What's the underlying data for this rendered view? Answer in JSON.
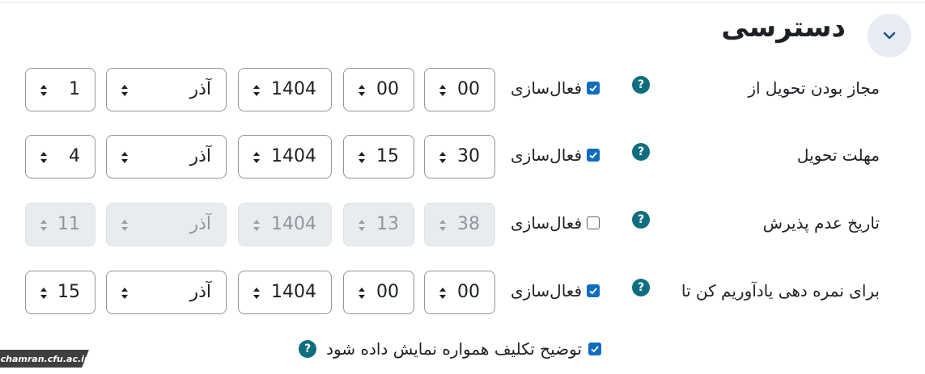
{
  "section": {
    "title": "دسترسی",
    "collapse_icon": "chevron-down-icon"
  },
  "enable_label": "فعال‌سازی",
  "rows": [
    {
      "label": "مجاز بودن تحویل از",
      "enabled": true,
      "minute": "00",
      "hour": "00",
      "year": "1404",
      "month": "آذر",
      "day": "1"
    },
    {
      "label": "مهلت تحویل",
      "enabled": true,
      "minute": "30",
      "hour": "15",
      "year": "1404",
      "month": "آذر",
      "day": "4"
    },
    {
      "label": "تاریخ عدم پذیرش",
      "enabled": false,
      "minute": "38",
      "hour": "13",
      "year": "1404",
      "month": "آذر",
      "day": "11"
    },
    {
      "label": "برای نمره دهی یادآوریم کن تا",
      "enabled": true,
      "minute": "00",
      "hour": "00",
      "year": "1404",
      "month": "آذر",
      "day": "15"
    }
  ],
  "always_show_description": {
    "label": "توضیح تکلیف همواره نمایش داده شود",
    "checked": true
  },
  "help_icon_glyph": "?",
  "watermark": "chamran.cfu.ac.ir",
  "colors": {
    "accent": "#0f6cbf",
    "help": "#0f6e7f",
    "collapse_bg": "#e7ebf3"
  }
}
